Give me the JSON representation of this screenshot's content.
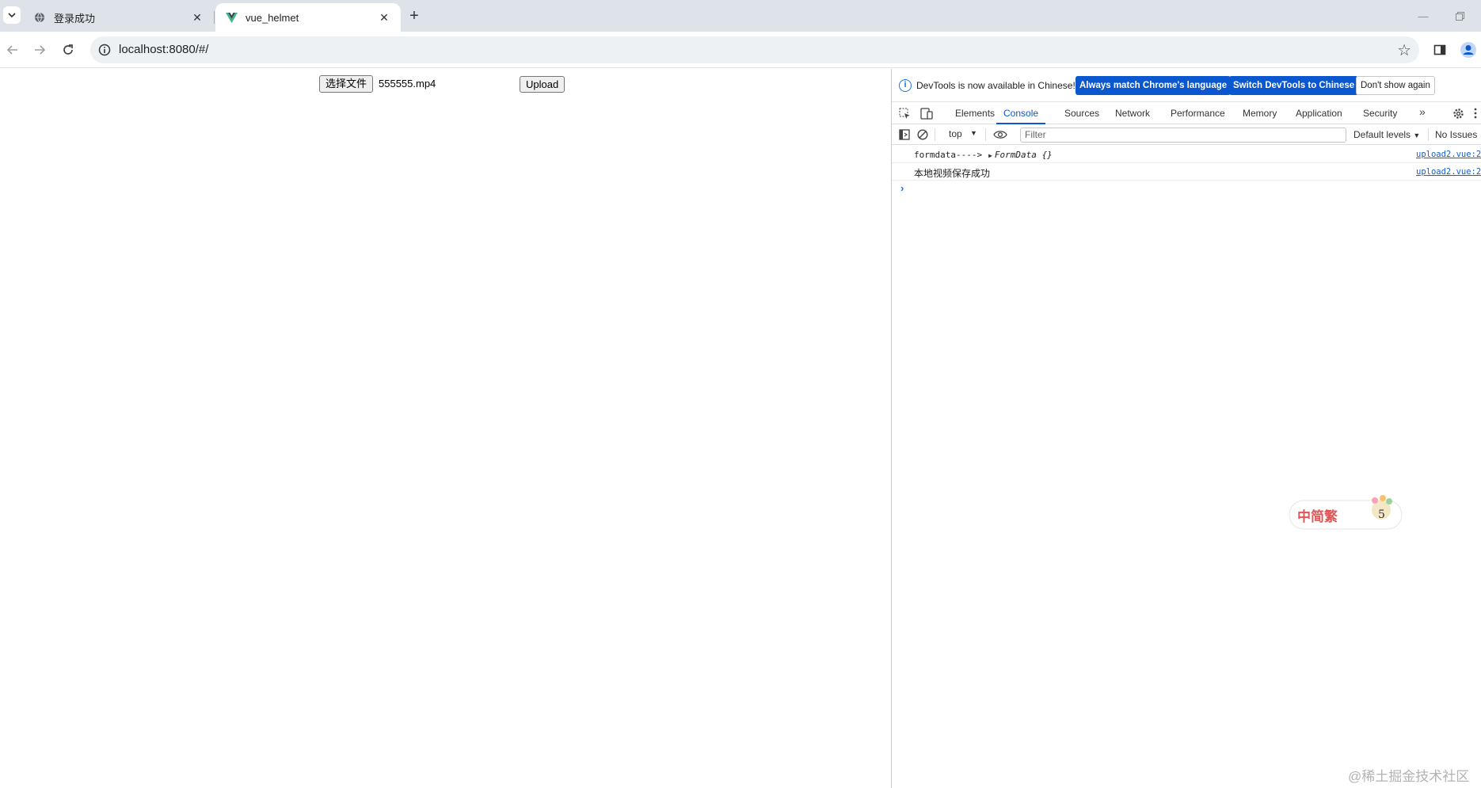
{
  "browser": {
    "tabs": [
      {
        "title": "登录成功",
        "icon": "globe-icon"
      },
      {
        "title": "vue_helmet",
        "icon": "vue-logo-icon"
      }
    ],
    "url": "localhost:8080/#/"
  },
  "page": {
    "choose_file_label": "选择文件",
    "file_name": "555555.mp4",
    "upload_label": "Upload"
  },
  "devtools": {
    "info_text": "DevTools is now available in Chinese!",
    "match_language_label": "Always match Chrome's language",
    "switch_chinese_label": "Switch DevTools to Chinese",
    "dont_show_label": "Don't show again",
    "tabs": [
      "Elements",
      "Console",
      "Sources",
      "Network",
      "Performance",
      "Memory",
      "Application",
      "Security"
    ],
    "active_tab": "Console",
    "context": "top",
    "filter_placeholder": "Filter",
    "levels": "Default levels",
    "issues": "No Issues",
    "logs": [
      {
        "label": "formdata---->",
        "object": "FormData {}",
        "source": "upload2.vue:2"
      },
      {
        "message": "本地视频保存成功",
        "source": "upload2.vue:2"
      }
    ]
  },
  "overlay": {
    "sticker_text": "中简繁",
    "sticker_number": "5",
    "watermark": "@稀土掘金技术社区"
  },
  "colors": {
    "accent": "#0b57d0",
    "link": "#1a5fc7",
    "tabstrip": "#dee3ea"
  }
}
